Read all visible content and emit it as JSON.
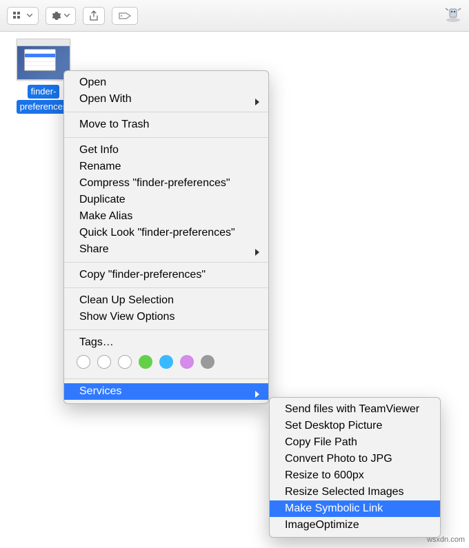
{
  "file": {
    "name_line1": "finder-",
    "name_line2": "preferences"
  },
  "menu": {
    "open": "Open",
    "open_with": "Open With",
    "move_to_trash": "Move to Trash",
    "get_info": "Get Info",
    "rename": "Rename",
    "compress": "Compress \"finder-preferences\"",
    "duplicate": "Duplicate",
    "make_alias": "Make Alias",
    "quick_look": "Quick Look \"finder-preferences\"",
    "share": "Share",
    "copy": "Copy \"finder-preferences\"",
    "clean_up": "Clean Up Selection",
    "view_options": "Show View Options",
    "tags": "Tags…",
    "services": "Services"
  },
  "tag_colors": [
    "#ffffff",
    "#ffffff",
    "#ffffff",
    "#64d04a",
    "#3bb9ff",
    "#d48be9",
    "#9a9a9a"
  ],
  "submenu": {
    "items": [
      "Send files with TeamViewer",
      "Set Desktop Picture",
      "Copy File Path",
      "Convert Photo to JPG",
      "Resize to 600px",
      "Resize Selected Images",
      "Make Symbolic Link",
      "ImageOptimize"
    ],
    "selected_index": 6
  },
  "watermark": "wsxdn.com"
}
